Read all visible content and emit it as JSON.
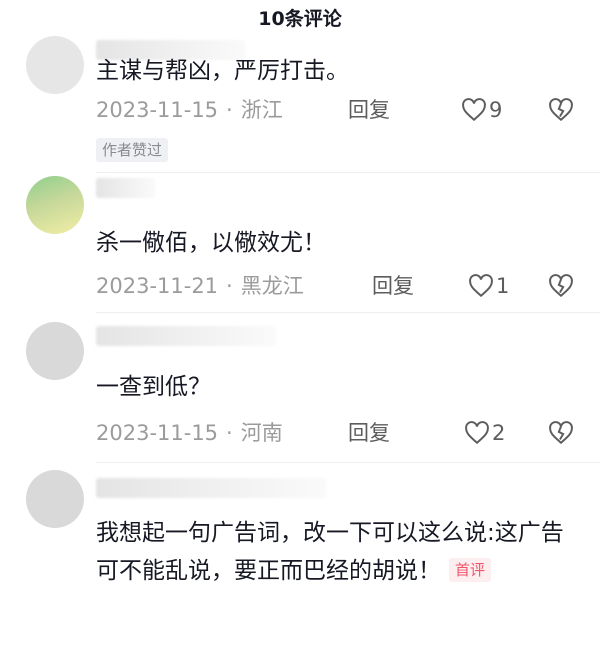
{
  "header": {
    "title": "10条评论"
  },
  "comments": [
    {
      "username": "",
      "text": "主谋与帮凶，严厉打击。",
      "date": "2023-11-15",
      "location": "浙江",
      "reply_label": "回复",
      "likes": "9",
      "badge": "作者赞过"
    },
    {
      "username": "",
      "text": "杀一儆佰，以儆效尤！",
      "date": "2023-11-21",
      "location": "黑龙江",
      "reply_label": "回复",
      "likes": "1"
    },
    {
      "username": "",
      "text": "一查到低？",
      "date": "2023-11-15",
      "location": "河南",
      "reply_label": "回复",
      "likes": "2"
    },
    {
      "username": "",
      "text": "我想起一句广告词，改一下可以这么说:这广告可不能乱说，要正而巴经的胡说！",
      "badge": "首评"
    }
  ],
  "icons": {
    "like": "heart-outline-icon",
    "dislike": "broken-heart-icon"
  },
  "colors": {
    "text": "#161823",
    "meta": "#9b9b9b",
    "first_badge": "#f2546b"
  }
}
